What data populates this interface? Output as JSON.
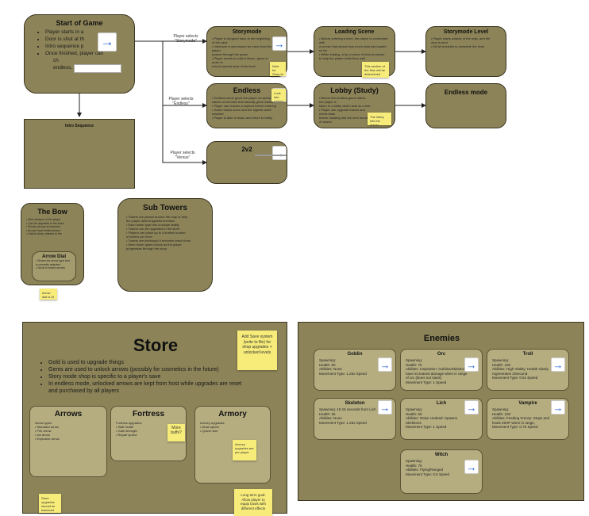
{
  "start": {
    "title": "Start of Game",
    "bullets": [
      "Player starts in a",
      "Door is shut at th",
      "Intro sequence p",
      "Once finished, player can"
    ],
    "bullets_tail": [
      "ch",
      "endless, or versus"
    ]
  },
  "intro": {
    "title": "Intro Sequence"
  },
  "edges": {
    "storymode": "Player selects \"Storymode\"",
    "endless": "Player selects \"Endless\"",
    "versus": "Player selects \"Versus\""
  },
  "storymode": {
    "title": "Storymode",
    "text": [
      "• Player is dropped back at the beginning of the cave",
      "• Intrdouce a new lesson for each level the player",
      "   passes through the game",
      "• Player needs to collect items / gems in order to",
      "   unlock special area of the level"
    ],
    "note": "Note for Story to be determined"
  },
  "loading": {
    "title": "Loading Scene",
    "text": [
      "• Before entering a level, the player is confronted with",
      "   a screen that shows how much data has loaded so far",
      "• While loading, a tip or piece of trivia is shown",
      "   to help the player while they wait"
    ],
    "note": "This section of the flow will be determined later"
  },
  "story_level": {
    "title": "Storymode Level",
    "text": [
      "• Player starts outside of the map, and the",
      "   door is shut",
      "• Kill all enemies to complete the level"
    ]
  },
  "endless": {
    "title": "Endless",
    "text": [
      "• Endless mode gives the player an arena with",
      "   waves of enemies that steadily grow harder",
      "• Player can choose a loadout before entering",
      "• Game tracks score and the highest wave reached",
      "• Player is able to leave and return to lobby"
    ],
    "note": "Look into saving this section"
  },
  "lobby": {
    "title": "Lobby (Study)",
    "text": [
      "• Before the endless game starts, the player is",
      "   taken to a lobby which acts as a hub",
      "• Player can upgrade towers and check stats",
      "   before heading into the next round of waves"
    ],
    "note": "The lobby lets the player prepare before starting"
  },
  "endless_mode": {
    "title": "Endless mode"
  },
  "versus": {
    "title": "2v2"
  },
  "bow": {
    "title": "The Bow",
    "text": [
      "• Main weapon of the player",
      "• Can be upgraded in the store",
      "• Shoots arrows at enemies",
      "• Arrows have limited ammo",
      "• Hold to draw, release to fire"
    ],
    "dial_title": "Arrow Dial",
    "dial_text": [
      "• Shows the arrow type that",
      "   is currently selected",
      "• Scroll to switch arrows"
    ],
    "note": "Arrow dial is UI for the bow"
  },
  "towers": {
    "title": "Sub Towers",
    "text": [
      "• Towers are placed around the map to help",
      "   the player defend against enemies",
      "• Each tower type has a unique ability",
      "• Towers can be upgraded in the store",
      "• Players can place up to a limited number",
      "   of towers per level",
      "• Towers are destroyed if enemies reach them",
      "• More tower types unlock as the player",
      "   progresses through the story"
    ]
  },
  "store": {
    "title": "Store",
    "bullets": [
      "Gold is used to upgrade things",
      "Gems are used to unlock arrows (possibly for cosmetics in the future)",
      "Story mode shop is specific to a player's save",
      "In endless mode, unlocked arrows are kept from host while upgrades are reset and purchased by all players"
    ],
    "note_save": "Add Save system (write to file) for shop upgrades + unlocked levels",
    "arrows": {
      "title": "Arrows",
      "text": [
        "Arrow types",
        "• Standard arrow",
        "• Fire arrow",
        "• Ice arrow",
        "• Explosive arrow"
      ]
    },
    "fortress": {
      "title": "Fortress",
      "text": [
        "Fortress upgrades",
        "• Wall health",
        "• Gate strength",
        "• Repair speed"
      ]
    },
    "fortress_note": "More buffs?",
    "armory": {
      "title": "Armory",
      "text": [
        "Armory upgrades",
        "• Draw speed",
        "• Quiver size"
      ]
    },
    "armory_note": "Armory upgrades are per player",
    "note_bottom_left": "Store upgrades should be balanced",
    "note_long_term": "Long term goal: Allow player to equip bows with different effects"
  },
  "enemies": {
    "title": "Enemies",
    "cards": [
      {
        "name": "Goblin",
        "text": [
          "Spawning:",
          "Health: 50",
          "Abilities: None",
          "Movement Type: 1.25x Speed"
        ]
      },
      {
        "name": "Orc",
        "text": [
          "Spawning:",
          "Health: 75",
          "Abilities: Inspiration: Goblins/Skeletons",
          "have increased damage when in range",
          "of orc (Does not stack)",
          "Movement Type: 1 Speed"
        ]
      },
      {
        "name": "Troll",
        "text": [
          "Spawning:",
          "Health: 100",
          "Abilities: High Vitality: Health slowly",
          "regenerates 3/Second",
          "Movement Type: 0.5x Speed"
        ]
      },
      {
        "name": "Skeleton",
        "text": [
          "Spawning: 10-15 seconds from Lich",
          "Health: 25",
          "Abilities: None",
          "Movement Type: 1.25x Speed"
        ]
      },
      {
        "name": "Lich",
        "text": [
          "Spawning:",
          "Health: 50",
          "Abilities: Raise Undead: Spawns",
          "Skeletons",
          "Movement Type: 1 Speed"
        ]
      },
      {
        "name": "Vampire",
        "text": [
          "Spawning:",
          "Health: 100",
          "Abilities: Feeding Frenzy: Stops and",
          "heals 25HP when in range,",
          "Movement Type: 0.75 Speed"
        ]
      },
      {
        "name": "Witch",
        "text": [
          "Spawning:",
          "Health: 75",
          "Abilities: Flying/Ranged",
          "Movement Type: 0.5 Speed"
        ]
      }
    ]
  },
  "icons": {
    "link": "arrow-right-icon",
    "accent": "#1e5bdb"
  },
  "colors": {
    "node": "#8c8358",
    "note": "#f7ec7a"
  }
}
